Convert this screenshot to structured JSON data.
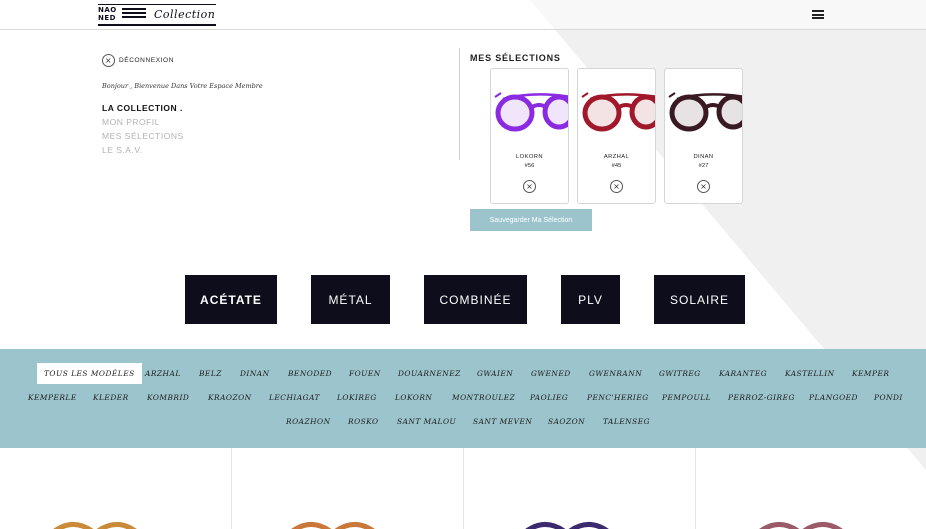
{
  "header": {
    "logo": {
      "mark_top": "NAO",
      "mark_bottom": "NED",
      "wordmark": "Collection"
    },
    "menu_icon": "hamburger-menu-icon"
  },
  "member": {
    "logout_label": "DÉCONNEXION",
    "logout_icon": "close-circle-icon",
    "welcome": "Bonjour , Bienvenue Dans Votre Espace Membre",
    "nav": [
      {
        "label": "LA COLLECTION .",
        "active": true
      },
      {
        "label": "MON PROFIL",
        "active": false
      },
      {
        "label": "MES SÉLECTIONS",
        "active": false
      },
      {
        "label": "LE S.A.V.",
        "active": false
      }
    ]
  },
  "selections": {
    "title": "MES SÉLECTIONS",
    "items": [
      {
        "name": "LOKORN",
        "number": "#56",
        "frame_color": "#8a2be2",
        "image": "purple-glasses"
      },
      {
        "name": "ARZHAL",
        "number": "#45",
        "frame_color": "#a0182a",
        "image": "red-glasses"
      },
      {
        "name": "DINAN",
        "number": "#27",
        "frame_color": "#3a1a22",
        "image": "tortoise-glasses"
      }
    ],
    "remove_icon": "close-circle-icon",
    "save_button": "Sauvegarder Ma Sélection"
  },
  "materials": [
    {
      "label": "ACÉTATE",
      "active": true
    },
    {
      "label": "MÉTAL",
      "active": false
    },
    {
      "label": "COMBINÉE",
      "active": false
    },
    {
      "label": "PLV",
      "active": false
    },
    {
      "label": "SOLAIRE",
      "active": false
    }
  ],
  "filters": [
    "TOUS LES MODÈLES",
    "ARZHAL",
    "BELZ",
    "DINAN",
    "BENODED",
    "FOUEN",
    "DOUARNENEZ",
    "GWAIEN",
    "GWENED",
    "GWENRANN",
    "GWITREG",
    "KARANTEG",
    "KASTELLIN",
    "KEMPER",
    "KEMPERLE",
    "KLEDER",
    "KOMBRID",
    "KRAOZON",
    "LECHIAGAT",
    "LOKIREG",
    "LOKORN",
    "MONTROULEZ",
    "PAOLIEG",
    "PENC'HERIEG",
    "PEMPOULL",
    "PERROZ-GIREG",
    "PLANGOED",
    "PONDI",
    "ROAZHON",
    "ROSKO",
    "SANT MALOU",
    "SANT MEVEN",
    "SAOZON",
    "TALENSEG"
  ],
  "active_filter": "TOUS LES MODÈLES",
  "colors": {
    "dark": "#0e0d1c",
    "band": "#9cc4cd",
    "inactive_nav": "#b3b3b3",
    "diagonal": "#f0f0f0"
  },
  "products": [
    {
      "frame_color": "#c98a3a"
    },
    {
      "frame_color": "#c9783a"
    },
    {
      "frame_color": "#3b2a6e"
    },
    {
      "frame_color": "#9a5a6a"
    }
  ]
}
